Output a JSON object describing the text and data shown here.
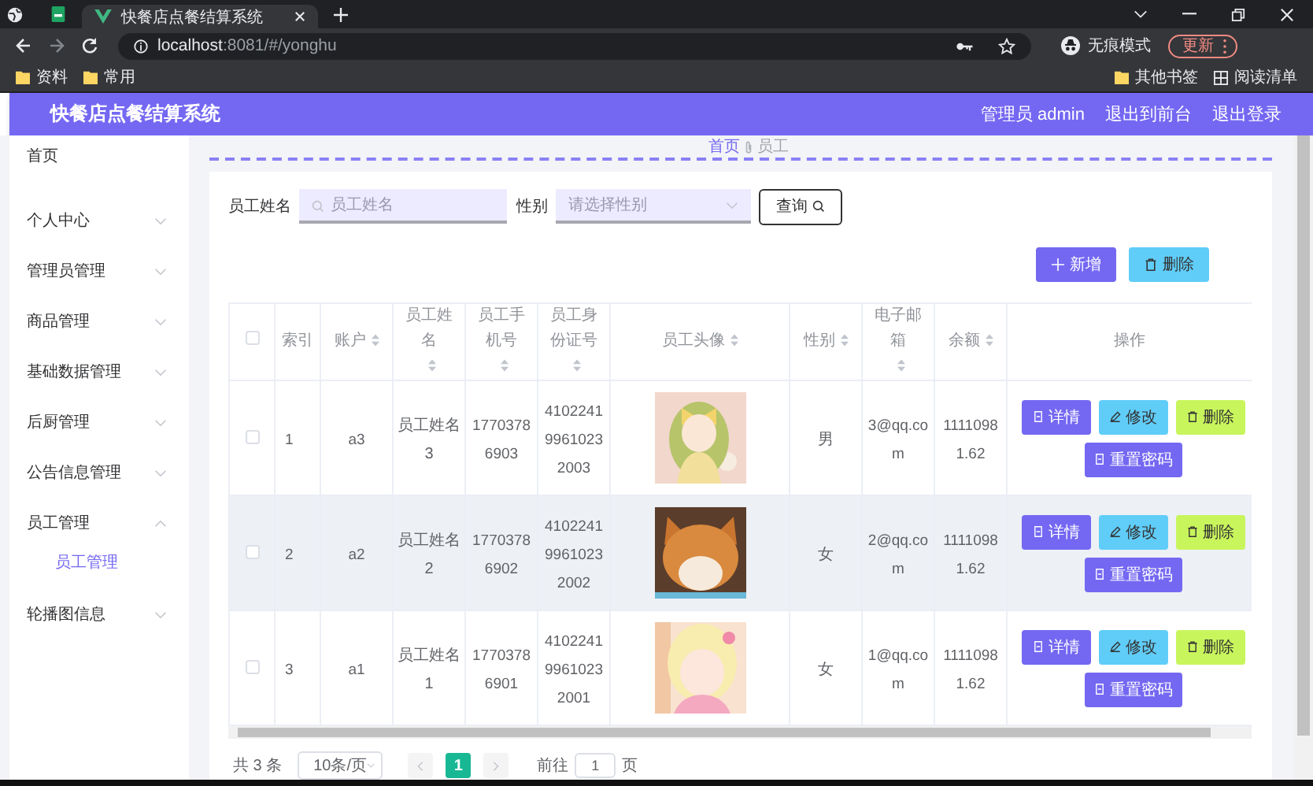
{
  "browser": {
    "tabs": [
      {
        "title": "快餐店点餐结算系统",
        "selected": true
      }
    ],
    "url_host": "localhost",
    "url_rest": ":8081/#/yonghu",
    "profile_label": "无痕模式",
    "update_label": "更新",
    "bookmarks_left": [
      "资料",
      "常用"
    ],
    "bookmarks_right": [
      {
        "label": "其他书签",
        "kind": "folder"
      },
      {
        "label": "阅读清单",
        "kind": "list"
      }
    ]
  },
  "header": {
    "title": "快餐店点餐结算系统",
    "links": [
      "管理员 admin",
      "退出到前台",
      "退出登录"
    ]
  },
  "sidebar": {
    "items": [
      {
        "label": "首页",
        "kind": "link"
      },
      {
        "label": "个人中心",
        "kind": "submenu",
        "expanded": false
      },
      {
        "label": "管理员管理",
        "kind": "submenu",
        "expanded": false
      },
      {
        "label": "商品管理",
        "kind": "submenu",
        "expanded": false
      },
      {
        "label": "基础数据管理",
        "kind": "submenu",
        "expanded": false
      },
      {
        "label": "后厨管理",
        "kind": "submenu",
        "expanded": false
      },
      {
        "label": "公告信息管理",
        "kind": "submenu",
        "expanded": false
      },
      {
        "label": "员工管理",
        "kind": "submenu",
        "expanded": true,
        "children": [
          {
            "label": "员工管理",
            "selected": true
          }
        ]
      },
      {
        "label": "轮播图信息",
        "kind": "submenu",
        "expanded": false
      }
    ]
  },
  "breadcrumb": [
    "首页",
    "员工"
  ],
  "search": {
    "fields": [
      {
        "label": "员工姓名",
        "placeholder": "员工姓名",
        "kind": "text"
      },
      {
        "label": "性别",
        "placeholder": "请选择性别",
        "kind": "select"
      }
    ],
    "button": "查询"
  },
  "actions": [
    {
      "label": "新增",
      "kind": "add"
    },
    {
      "label": "删除",
      "kind": "delete"
    }
  ],
  "table": {
    "columns": [
      {
        "kind": "checkbox",
        "checked": false
      },
      {
        "label": "索引",
        "sortable": false
      },
      {
        "label": "账户",
        "sortable": true
      },
      {
        "label": "员工姓名",
        "sortable": true
      },
      {
        "label": "员工手机号",
        "sortable": true
      },
      {
        "label": "员工身份证号",
        "sortable": true
      },
      {
        "label": "员工头像",
        "sortable": true
      },
      {
        "label": "性别",
        "sortable": true
      },
      {
        "label": "电子邮箱",
        "sortable": true
      },
      {
        "label": "余额",
        "sortable": true
      },
      {
        "label": "操作",
        "sortable": false
      }
    ],
    "rows": [
      {
        "checked": false,
        "highlighted": false,
        "index": "1",
        "account": "a3",
        "name": "员工姓名3",
        "phone": "17703786903",
        "id_number": "410224199610232003",
        "gender": "男",
        "email": "3@qq.com",
        "balance": "11110981.62",
        "buttons": [
          {
            "label": "详情",
            "kind": "detail"
          },
          {
            "label": "修改",
            "kind": "edit"
          },
          {
            "label": "删除",
            "kind": "delete"
          },
          {
            "label": "重置密码",
            "kind": "reset"
          }
        ]
      },
      {
        "checked": false,
        "highlighted": true,
        "index": "2",
        "account": "a2",
        "name": "员工姓名2",
        "phone": "17703786902",
        "id_number": "410224199610232002",
        "gender": "女",
        "email": "2@qq.com",
        "balance": "11110981.62",
        "buttons": [
          {
            "label": "详情",
            "kind": "detail"
          },
          {
            "label": "修改",
            "kind": "edit"
          },
          {
            "label": "删除",
            "kind": "delete"
          },
          {
            "label": "重置密码",
            "kind": "reset"
          }
        ]
      },
      {
        "checked": false,
        "highlighted": false,
        "index": "3",
        "account": "a1",
        "name": "员工姓名1",
        "phone": "17703786901",
        "id_number": "410224199610232001",
        "gender": "女",
        "email": "1@qq.com",
        "balance": "11110981.62",
        "buttons": [
          {
            "label": "详情",
            "kind": "detail"
          },
          {
            "label": "修改",
            "kind": "edit"
          },
          {
            "label": "删除",
            "kind": "delete"
          },
          {
            "label": "重置密码",
            "kind": "reset"
          }
        ]
      }
    ]
  },
  "pagination": {
    "total": "共 3 条",
    "page_size": "10条/页",
    "pages": [
      {
        "label": "1",
        "selected": true
      }
    ],
    "goto_label": "前往",
    "goto_value": "1",
    "goto_unit": "页"
  }
}
